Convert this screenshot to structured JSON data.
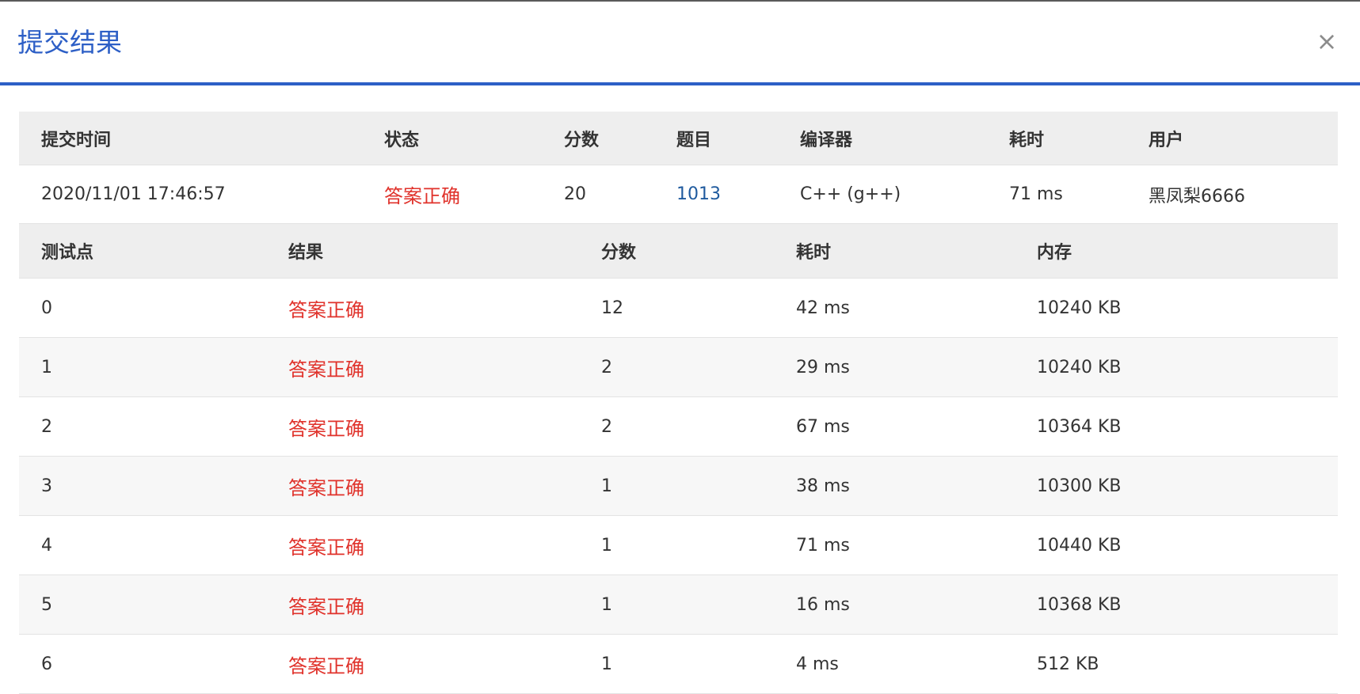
{
  "dialog": {
    "title": "提交结果",
    "close_label": "×"
  },
  "summary": {
    "headers": [
      "提交时间",
      "状态",
      "分数",
      "题目",
      "编译器",
      "耗时",
      "用户"
    ],
    "row": {
      "time": "2020/11/01 17:46:57",
      "status": "答案正确",
      "score": "20",
      "problem": "1013",
      "compiler": "C++ (g++)",
      "elapsed": "71 ms",
      "user": "黑凤梨6666"
    }
  },
  "cases": {
    "headers": [
      "测试点",
      "结果",
      "分数",
      "耗时",
      "内存"
    ],
    "rows": [
      {
        "id": "0",
        "result": "答案正确",
        "score": "12",
        "time": "42 ms",
        "memory": "10240 KB"
      },
      {
        "id": "1",
        "result": "答案正确",
        "score": "2",
        "time": "29 ms",
        "memory": "10240 KB"
      },
      {
        "id": "2",
        "result": "答案正确",
        "score": "2",
        "time": "67 ms",
        "memory": "10364 KB"
      },
      {
        "id": "3",
        "result": "答案正确",
        "score": "1",
        "time": "38 ms",
        "memory": "10300 KB"
      },
      {
        "id": "4",
        "result": "答案正确",
        "score": "1",
        "time": "71 ms",
        "memory": "10440 KB"
      },
      {
        "id": "5",
        "result": "答案正确",
        "score": "1",
        "time": "16 ms",
        "memory": "10368 KB"
      },
      {
        "id": "6",
        "result": "答案正确",
        "score": "1",
        "time": "4 ms",
        "memory": "512 KB"
      }
    ]
  },
  "colors": {
    "accent": "#2d5fc6",
    "accepted": "#e0322b",
    "link": "#1f5a9e",
    "header_bg": "#eeeeee"
  }
}
